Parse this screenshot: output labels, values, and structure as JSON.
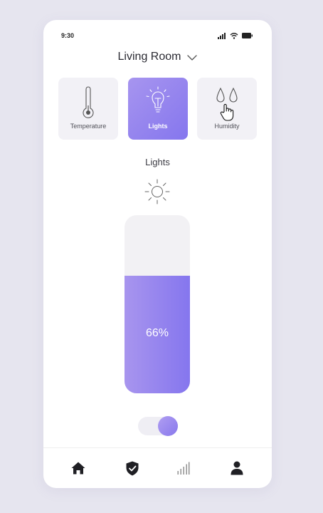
{
  "status_bar": {
    "time": "9:30"
  },
  "header": {
    "room_name": "Living Room"
  },
  "cards": [
    {
      "label": "Temperature",
      "icon": "thermometer-icon",
      "active": false
    },
    {
      "label": "Lights",
      "icon": "lightbulb-icon",
      "active": true
    },
    {
      "label": "Humidity",
      "icon": "water-drops-icon",
      "active": false
    }
  ],
  "lights": {
    "section_label": "Lights",
    "brightness_text": "66%",
    "brightness_fraction": 0.66,
    "power_on": true
  },
  "nav": [
    {
      "icon": "home-icon"
    },
    {
      "icon": "shield-check-icon"
    },
    {
      "icon": "stats-bars-icon"
    },
    {
      "icon": "user-icon"
    }
  ],
  "colors": {
    "accent_start": "#a795ef",
    "accent_end": "#8576ee",
    "card_bg": "#f2f1f6",
    "background": "#e6e5ef",
    "icon_dark": "#2b2b33"
  }
}
